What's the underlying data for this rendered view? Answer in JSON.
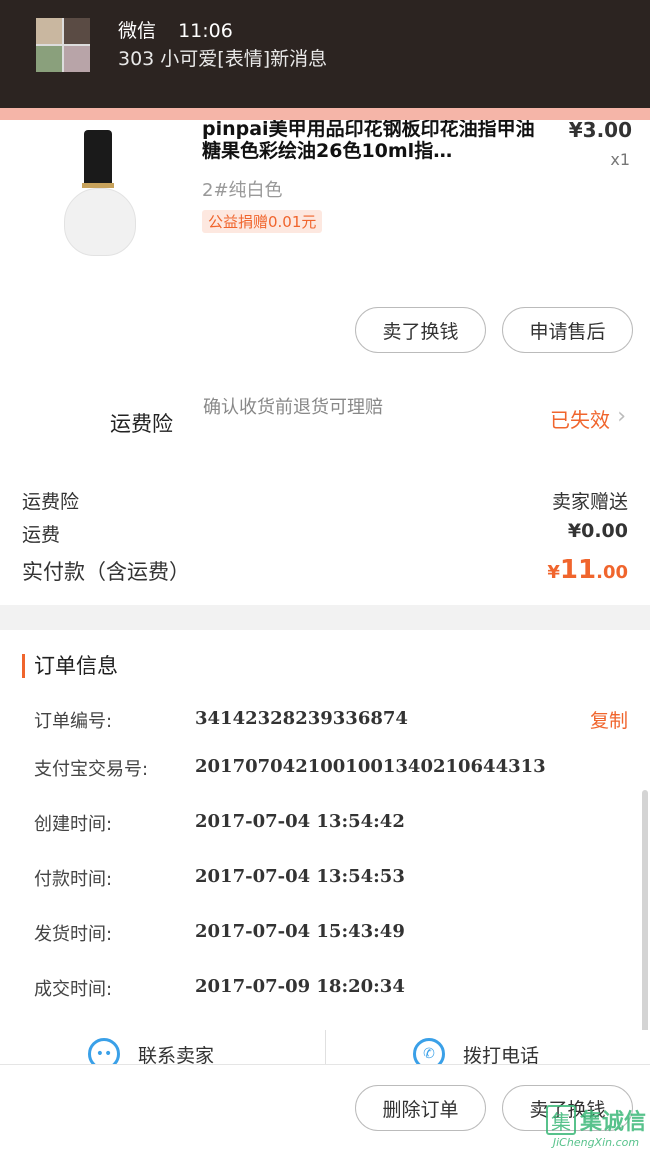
{
  "notification": {
    "app": "微信",
    "time": "11:06",
    "message": "303 小可爱[表情]新消息"
  },
  "product": {
    "title": "pinpai美甲用品印花钢板印花油指甲油糖果色彩绘油26色10ml指…",
    "price": "¥3.00",
    "quantity": "x1",
    "sku": "2#纯白色",
    "tag": "公益捐赠0.01元",
    "buttons": [
      "卖了换钱",
      "申请售后"
    ]
  },
  "insurance": {
    "label": "运费险",
    "description": "确认收货前退货可理赔",
    "status": "已失效"
  },
  "summary": {
    "rows": [
      {
        "label": "运费险",
        "value": "卖家赠送"
      },
      {
        "label": "运费",
        "value": "¥0.00"
      }
    ],
    "total_label": "实付款（含运费）",
    "total_currency": "¥",
    "total_integer": "11",
    "total_decimal": ".00"
  },
  "order_info": {
    "title": "订单信息",
    "copy_label": "复制",
    "rows": [
      {
        "label": "订单编号:",
        "value": "34142328239336874"
      },
      {
        "label": "支付宝交易号:",
        "value": "2017070421001001340210644313"
      },
      {
        "label": "创建时间:",
        "value": "2017-07-04 13:54:42"
      },
      {
        "label": "付款时间:",
        "value": "2017-07-04 13:54:53"
      },
      {
        "label": "发货时间:",
        "value": "2017-07-04 15:43:49"
      },
      {
        "label": "成交时间:",
        "value": "2017-07-09 18:20:34"
      }
    ]
  },
  "contact": {
    "seller": "联系卖家",
    "phone": "拨打电话"
  },
  "bottom": {
    "delete": "删除订单",
    "sell": "卖了换钱"
  },
  "watermark": {
    "logo": "集诚信",
    "url": "JiChengXin.com"
  }
}
